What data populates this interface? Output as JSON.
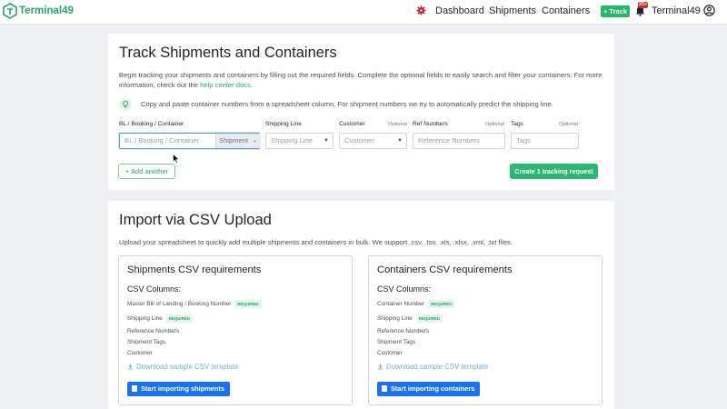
{
  "nav": {
    "brand": "Terminal49",
    "links": [
      "Dashboard",
      "Shipments",
      "Containers"
    ],
    "track_button": "+ Track",
    "notification_count": "20+",
    "org_name": "Terminal49"
  },
  "track": {
    "title": "Track Shipments and Containers",
    "description": "Begin tracking your shipments and containers by filling out the required fields. Complete the optional fields to easily search and filter your containers. For more information, check out the",
    "help_link": "help center docs",
    "description_end": ".",
    "tip": "Copy and paste container numbers from a spreadsheet column. For shipment numbers we try to automatically predict the shipping line.",
    "fields": {
      "bl": {
        "label": "BL / Booking / Container",
        "placeholder": "BL / Booking / Container",
        "type_value": "Shipment"
      },
      "line": {
        "label": "Shipping Line",
        "placeholder": "Shipping Line"
      },
      "customer": {
        "label": "Customer",
        "optional": "Optional",
        "placeholder": "Customer"
      },
      "ref": {
        "label": "Ref Numbers",
        "optional": "Optional",
        "placeholder": "Reference Numbers"
      },
      "tags": {
        "label": "Tags",
        "optional": "Optional",
        "placeholder": "Tags"
      }
    },
    "add_another": "+ Add another",
    "create_button": "Create 1 tracking request"
  },
  "csv": {
    "title": "Import via CSV Upload",
    "description": "Upload your spreadsheet to quickly add multiple shipments and containers in bulk. We support .csv, .tsv, .xls, .xlsx, .xml, .txt files.",
    "shipments": {
      "title": "Shipments CSV requirements",
      "columns_title": "CSV Columns:",
      "columns": [
        {
          "name": "Master Bill of Landing / Booking Number",
          "badge": "REQUIRED"
        },
        {
          "name": "Shipping Line",
          "badge": "REQUIRED"
        },
        {
          "name": "Reference Numbers"
        },
        {
          "name": "Shipment Tags"
        },
        {
          "name": "Customer"
        }
      ],
      "download": "Download sample CSV template",
      "start_button": "Start importing shipments"
    },
    "containers": {
      "title": "Containers CSV requirements",
      "columns_title": "CSV Columns:",
      "columns": [
        {
          "name": "Container Number",
          "badge": "REQUIRED"
        },
        {
          "name": "Shipping Line",
          "badge": "REQUIRED"
        },
        {
          "name": "Reference Numbers"
        },
        {
          "name": "Shipment Tags"
        },
        {
          "name": "Customer"
        }
      ],
      "download": "Download sample CSV template",
      "start_button": "Start importing containers"
    }
  },
  "colors": {
    "brand": "#27a567",
    "primary": "#1a73e8",
    "danger": "#d72b2b"
  }
}
